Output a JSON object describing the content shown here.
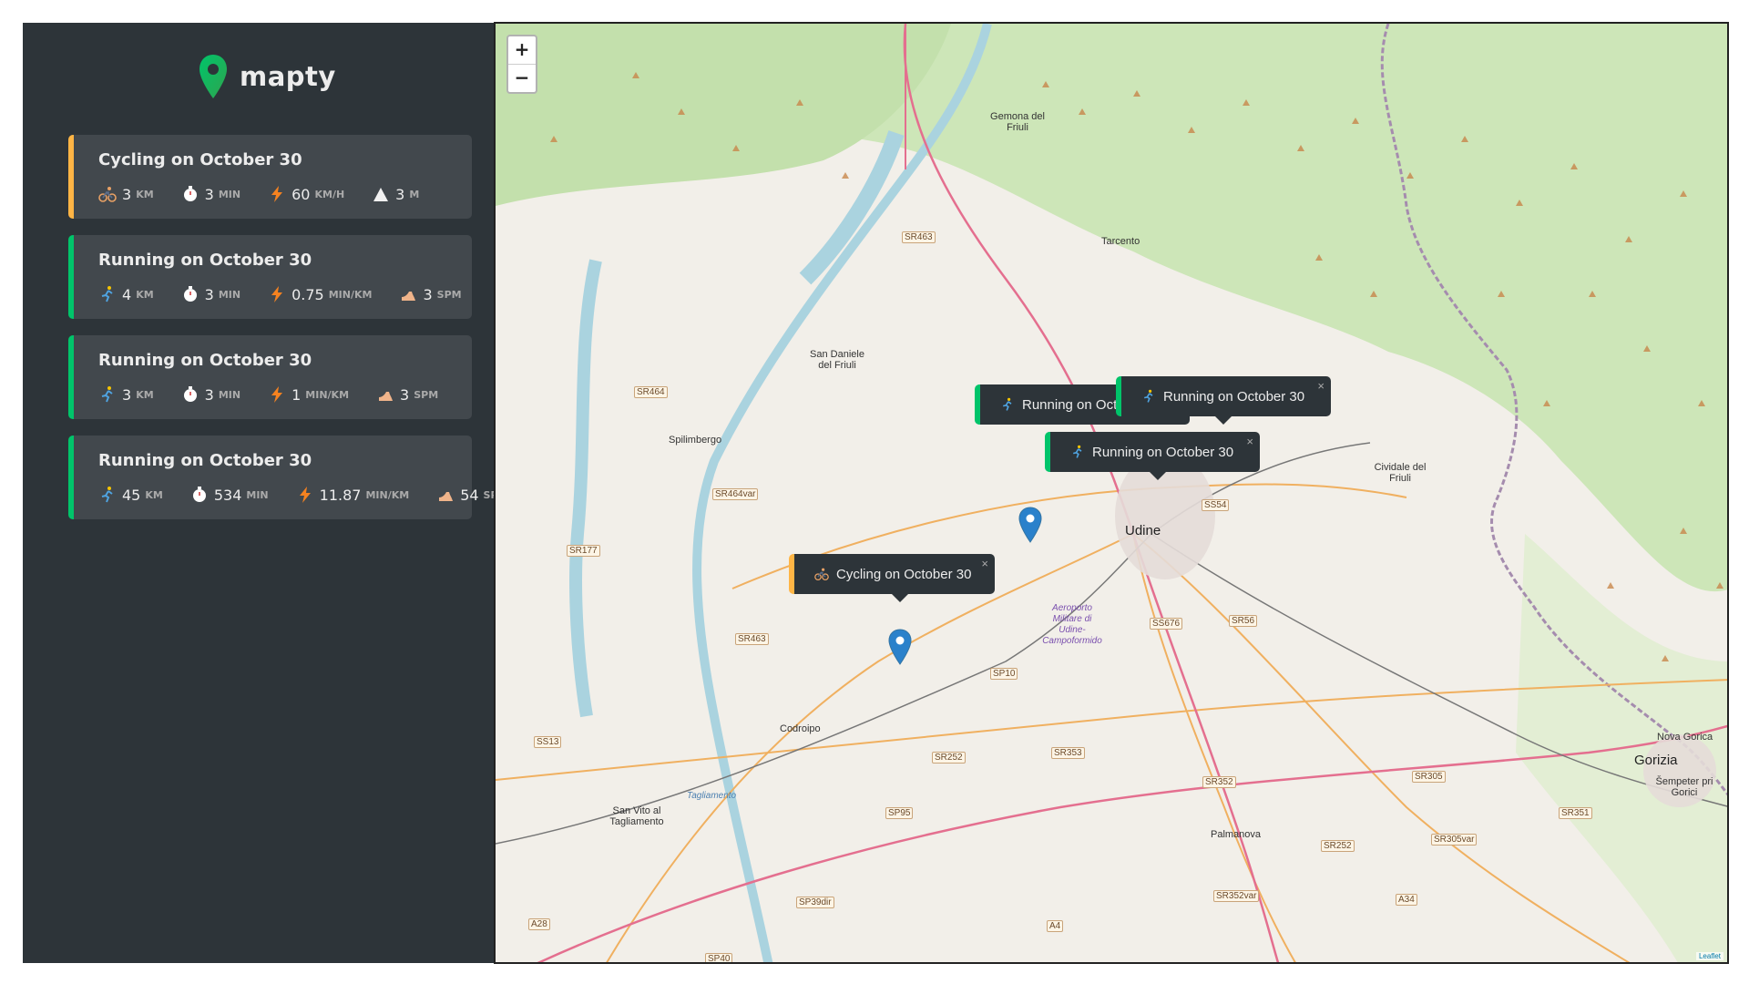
{
  "app": {
    "name": "mapty",
    "accent_running": "#00c46a",
    "accent_cycling": "#ffb545",
    "sidebar_bg": "#2d3439"
  },
  "workouts": [
    {
      "type": "cycling",
      "title": "Cycling on October 30",
      "distance": "3",
      "distance_unit": "km",
      "duration": "3",
      "duration_unit": "min",
      "speed": "60",
      "speed_unit": "km/h",
      "fourth": "3",
      "fourth_unit": "m",
      "icons": [
        "cyclist-icon",
        "stopwatch-icon",
        "lightning-icon",
        "mountain-icon"
      ]
    },
    {
      "type": "running",
      "title": "Running on October 30",
      "distance": "4",
      "distance_unit": "km",
      "duration": "3",
      "duration_unit": "min",
      "speed": "0.75",
      "speed_unit": "min/km",
      "fourth": "3",
      "fourth_unit": "spm",
      "icons": [
        "runner-icon",
        "stopwatch-icon",
        "lightning-icon",
        "footprint-icon"
      ]
    },
    {
      "type": "running",
      "title": "Running on October 30",
      "distance": "3",
      "distance_unit": "km",
      "duration": "3",
      "duration_unit": "min",
      "speed": "1",
      "speed_unit": "min/km",
      "fourth": "3",
      "fourth_unit": "spm",
      "icons": [
        "runner-icon",
        "stopwatch-icon",
        "lightning-icon",
        "footprint-icon"
      ]
    },
    {
      "type": "running",
      "title": "Running on October 30",
      "distance": "45",
      "distance_unit": "km",
      "duration": "534",
      "duration_unit": "min",
      "speed": "11.87",
      "speed_unit": "min/km",
      "fourth": "54",
      "fourth_unit": "spm",
      "icons": [
        "runner-icon",
        "stopwatch-icon",
        "lightning-icon",
        "footprint-icon"
      ]
    }
  ],
  "map": {
    "zoom_in": "+",
    "zoom_out": "−",
    "attribution": "Leaflet",
    "places": {
      "udine": "Udine",
      "gemona": "Gemona del Friuli",
      "tarcento": "Tarcento",
      "san_daniele": "San Daniele del Friuli",
      "spilimbergo": "Spilimbergo",
      "cividale": "Cividale del Friuli",
      "codroipo": "Codroipo",
      "san_vito": "San Vito al Tagliamento",
      "palmanova": "Palmanova",
      "gorizia": "Gorizia",
      "nova_gorica": "Nova Gorica",
      "sempeter": "Šempeter pri Gorici",
      "aeroporto": "Aeroporto Militare di Udine-Campoformido",
      "tagliamento": "Tagliamento"
    },
    "roads": [
      "SR463",
      "SR464",
      "SR464var",
      "SR177",
      "SR463",
      "SS54",
      "SS676",
      "SR56",
      "SP10",
      "SS13",
      "SR252",
      "SR353",
      "SR352",
      "SR305",
      "SR305var",
      "SR351",
      "SR252",
      "SP95",
      "SP39dir",
      "SR352var",
      "A34",
      "A4",
      "A28",
      "SP40"
    ],
    "popups": [
      {
        "type": "running",
        "label": "Running on October 30",
        "close": "×"
      },
      {
        "type": "running",
        "label": "Running on October 30",
        "close": "×"
      },
      {
        "type": "running",
        "label": "Running on October 30",
        "close": "×"
      },
      {
        "type": "cycling",
        "label": "Cycling on October 30",
        "close": "×"
      }
    ]
  }
}
